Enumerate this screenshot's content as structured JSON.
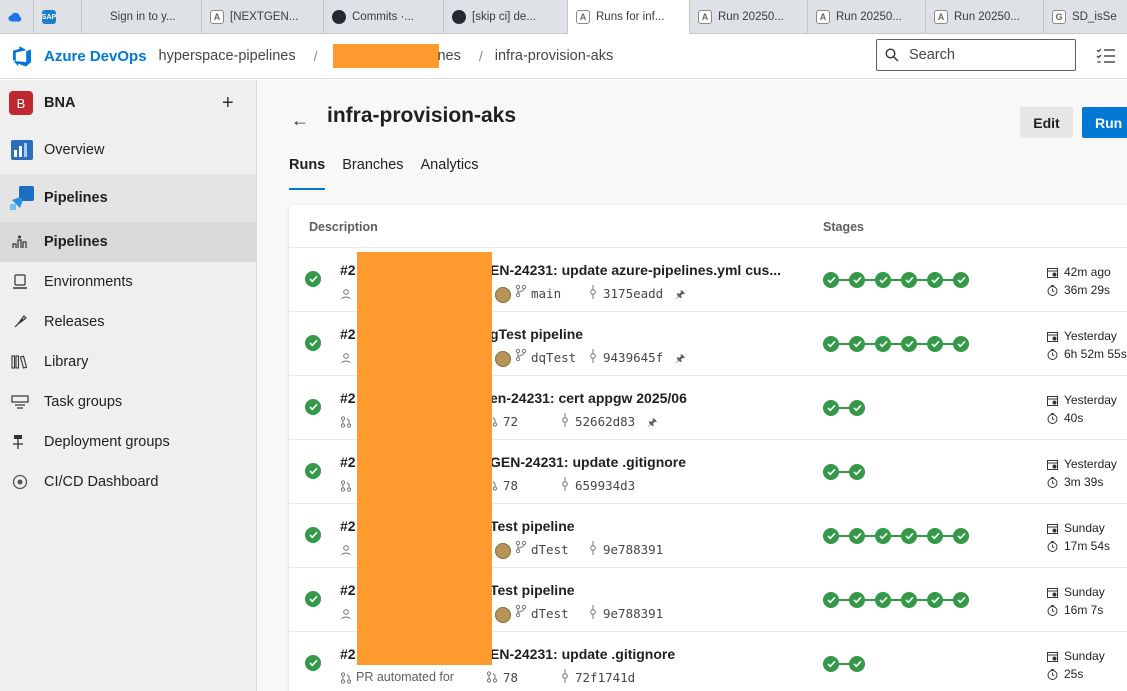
{
  "browser_tabs": [
    {
      "label": "",
      "icon": "cloud-icon",
      "active": false
    },
    {
      "label": "",
      "icon": "sap-icon",
      "active": false
    },
    {
      "label": "Sign in to y...",
      "icon": "microsoft-icon",
      "active": false
    },
    {
      "label": "[NEXTGEN...",
      "icon": "azure-devops-icon",
      "active": false
    },
    {
      "label": "Commits ·...",
      "icon": "github-icon",
      "active": false
    },
    {
      "label": "[skip ci] de...",
      "icon": "github-icon",
      "active": false
    },
    {
      "label": "Runs for inf...",
      "icon": "azure-devops-icon",
      "active": true
    },
    {
      "label": "Run 20250...",
      "icon": "azure-devops-icon",
      "active": false
    },
    {
      "label": "Run 20250...",
      "icon": "azure-devops-icon",
      "active": false
    },
    {
      "label": "Run 20250...",
      "icon": "azure-devops-icon",
      "active": false
    },
    {
      "label": "SD_isSe",
      "icon": "generic-icon",
      "active": false
    }
  ],
  "header": {
    "brand": "Azure DevOps",
    "org": "hyperspace-pipelines",
    "project_suffix": "nes",
    "pipeline": "infra-provision-aks",
    "search_placeholder": "Search"
  },
  "sidebar": {
    "org_initial": "B",
    "org_name": "BNA",
    "add_label": "+",
    "overview": "Overview",
    "section": "Pipelines",
    "items": [
      {
        "label": "Pipelines",
        "icon": "pipelines-rocket-icon",
        "selected": true
      },
      {
        "label": "Environments",
        "icon": "environments-icon",
        "selected": false
      },
      {
        "label": "Releases",
        "icon": "releases-icon",
        "selected": false
      },
      {
        "label": "Library",
        "icon": "library-icon",
        "selected": false
      },
      {
        "label": "Task groups",
        "icon": "task-groups-icon",
        "selected": false
      },
      {
        "label": "Deployment groups",
        "icon": "deployment-groups-icon",
        "selected": false
      },
      {
        "label": "CI/CD Dashboard",
        "icon": "dashboard-icon",
        "selected": false
      }
    ]
  },
  "page": {
    "title": "infra-provision-aks",
    "edit_label": "Edit",
    "run_label": "Run p",
    "tabs": [
      "Runs",
      "Branches",
      "Analytics"
    ],
    "active_tab": "Runs"
  },
  "table": {
    "headers": {
      "description": "Description",
      "stages": "Stages"
    },
    "rows": [
      {
        "num": "#2",
        "title_tail": "EN-24231: update azure-pipelines.yml cus...",
        "trigger": "manual",
        "reason": "",
        "branch": "main",
        "commit": "3175eadd",
        "pinned": true,
        "stages": 6,
        "when": "42m ago",
        "duration": "36m 29s"
      },
      {
        "num": "#2",
        "title_tail": "gTest pipeline",
        "trigger": "manual",
        "reason": "",
        "branch": "dqTest",
        "commit": "9439645f",
        "pinned": true,
        "stages": 6,
        "when": "Yesterday",
        "duration": "6h 52m 55s"
      },
      {
        "num": "#2",
        "title_tail": "en-24231: cert appgw 2025/06",
        "trigger": "pr",
        "reason": "",
        "branch": "72",
        "commit": "52662d83",
        "pinned": true,
        "stages": 2,
        "when": "Yesterday",
        "duration": "40s"
      },
      {
        "num": "#2",
        "title_tail": "GEN-24231: update .gitignore",
        "trigger": "pr",
        "reason": "",
        "branch": "78",
        "commit": "659934d3",
        "pinned": false,
        "stages": 2,
        "when": "Yesterday",
        "duration": "3m 39s"
      },
      {
        "num": "#2",
        "title_tail": "Test pipeline",
        "trigger": "manual",
        "reason": "",
        "branch": "dTest",
        "commit": "9e788391",
        "pinned": false,
        "stages": 6,
        "when": "Sunday",
        "duration": "17m 54s"
      },
      {
        "num": "#2",
        "title_tail": "Test pipeline",
        "trigger": "manual",
        "reason": "",
        "branch": "dTest",
        "commit": "9e788391",
        "pinned": false,
        "stages": 6,
        "when": "Sunday",
        "duration": "16m 7s"
      },
      {
        "num": "#2",
        "title_tail": "EN-24231: update .gitignore",
        "trigger": "pr",
        "reason": "PR automated for",
        "branch": "78",
        "commit": "72f1741d",
        "pinned": false,
        "stages": 2,
        "when": "Sunday",
        "duration": "25s"
      }
    ]
  },
  "colors": {
    "accent": "#0078d4",
    "success": "#339947",
    "redaction": "#ff9a2e",
    "org_badge": "#c0282f"
  }
}
